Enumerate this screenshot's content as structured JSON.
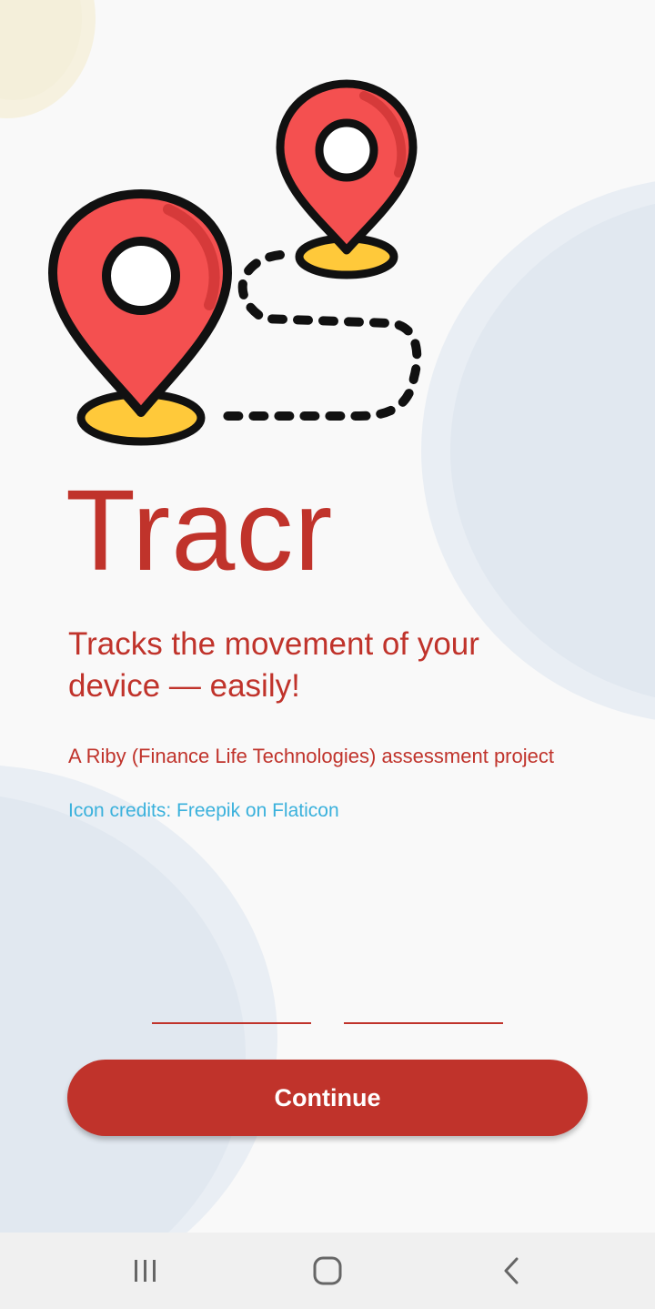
{
  "app": {
    "title": "Tracr",
    "tagline": "Tracks the movement of your device — easily!",
    "subtitle": "A Riby (Finance Life Technologies) assessment project",
    "credits": "Icon credits: Freepik on Flaticon",
    "continue_label": "Continue"
  },
  "hero": {
    "icon": "map-route-pins-icon"
  },
  "colors": {
    "brand": "#c0332b",
    "link": "#3ab1dc",
    "pin_red": "#f45050",
    "pin_base": "#ffc93a"
  },
  "navbar": {
    "recents_icon": "recents-icon",
    "home_icon": "home-icon",
    "back_icon": "back-icon"
  }
}
